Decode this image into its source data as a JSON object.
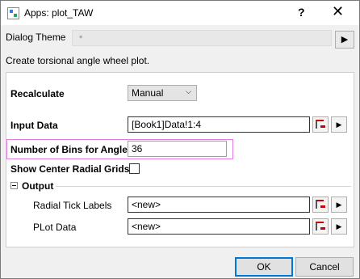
{
  "window": {
    "title": "Apps: plot_TAW",
    "help": "?",
    "close": "✕"
  },
  "theme": {
    "label": "Dialog Theme",
    "value": "*",
    "arrow": "▶"
  },
  "description": "Create torsional angle wheel plot.",
  "form": {
    "recalculate": {
      "label": "Recalculate",
      "value": "Manual",
      "arrow": "⌵"
    },
    "input_data": {
      "label": "Input Data",
      "value": "[Book1]Data!1:4"
    },
    "bins": {
      "label": "Number of Bins for Angles",
      "value": "36"
    },
    "center_grids": {
      "label": "Show Center Radial Grids",
      "checked": false
    }
  },
  "output": {
    "label": "Output",
    "radial_tick_labels": {
      "label": "Radial Tick Labels",
      "value": "<new>"
    },
    "plot_data": {
      "label": "PLot Data",
      "value": "<new>"
    }
  },
  "buttons": {
    "ok": "OK",
    "cancel": "Cancel"
  },
  "arrow_glyph": "▶"
}
